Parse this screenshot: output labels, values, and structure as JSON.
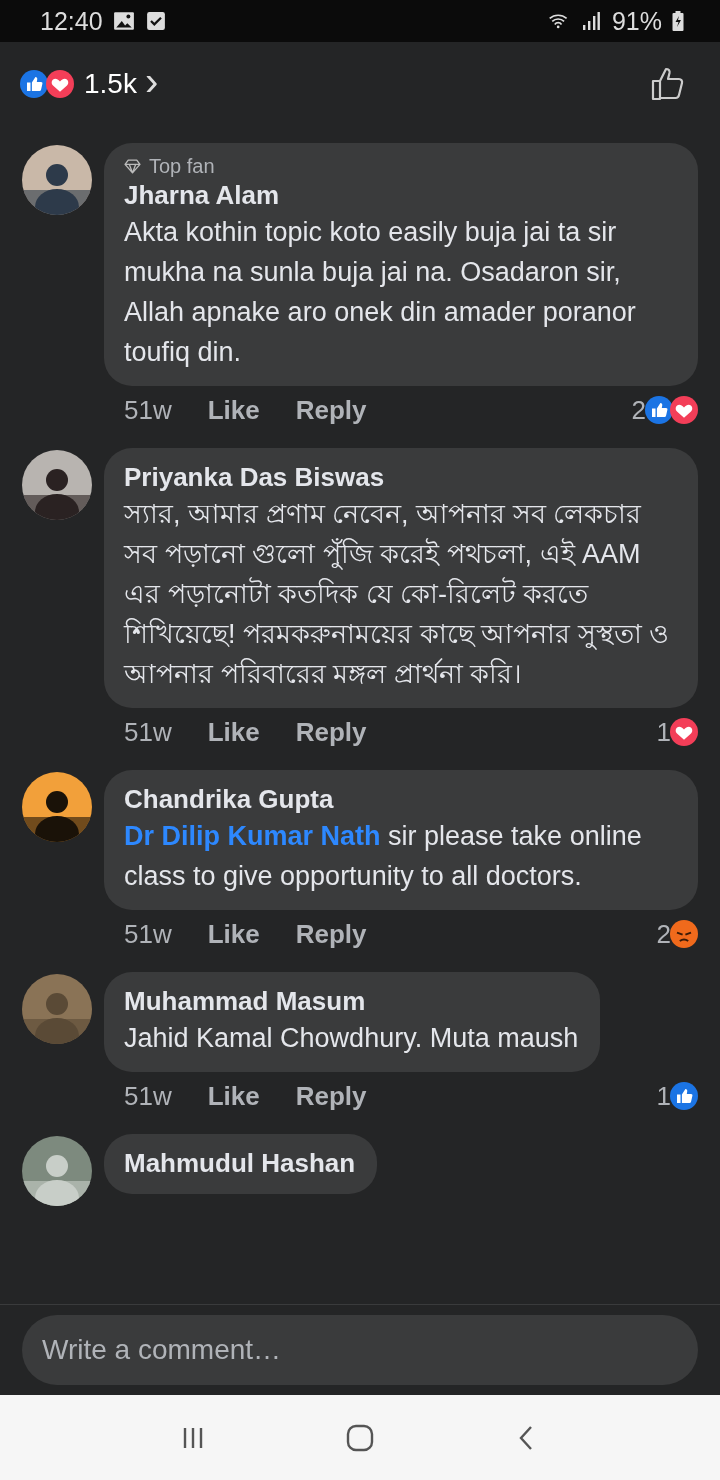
{
  "status_bar": {
    "time": "12:40",
    "battery": "91%"
  },
  "header": {
    "reactions": [
      {
        "kind": "like"
      },
      {
        "kind": "love"
      }
    ],
    "count": "1.5k",
    "chevron": "›"
  },
  "comments": [
    {
      "badge": "Top fan",
      "name": "Jharna Alam",
      "text": "Akta kothin topic koto easily buja jai ta sir mukha na sunla buja jai na. Osadaron sir, Allah apnake aro onek din amader poranor toufiq din.",
      "time": "51w",
      "like": "Like",
      "reply": "Reply",
      "reaction_count": "2",
      "reactions": [
        {
          "kind": "like"
        },
        {
          "kind": "love"
        }
      ]
    },
    {
      "name": "Priyanka Das Biswas",
      "text": "স্যার, আমার প্রণাম নেবেন, আপনার সব লেকচার সব পড়ানো গুলো পুঁজি করেই পথচলা, এই AAM এর পড়ানোটা কতদিক যে কো-রিলেট করতে শিখিয়েছে! পরমকরুনাময়ের কাছে আপনার সুস্থতা ও আপনার পরিবারের মঙ্গল প্রার্থনা করি।",
      "time": "51w",
      "like": "Like",
      "reply": "Reply",
      "reaction_count": "1",
      "reactions": [
        {
          "kind": "love"
        }
      ]
    },
    {
      "name": "Chandrika Gupta",
      "mention": "Dr Dilip Kumar Nath",
      "text": "sir please take online class to give opportunity to all doctors.",
      "time": "51w",
      "like": "Like",
      "reply": "Reply",
      "reaction_count": "2",
      "reactions": [
        {
          "kind": "angry"
        }
      ]
    },
    {
      "name": "Muhammad Masum",
      "text": "Jahid Kamal Chowdhury. Muta maush",
      "time": "51w",
      "like": "Like",
      "reply": "Reply",
      "reaction_count": "1",
      "reactions": [
        {
          "kind": "like"
        }
      ]
    },
    {
      "name": "Mahmudul Hashan"
    }
  ],
  "composer": {
    "placeholder": "Write a comment…"
  }
}
